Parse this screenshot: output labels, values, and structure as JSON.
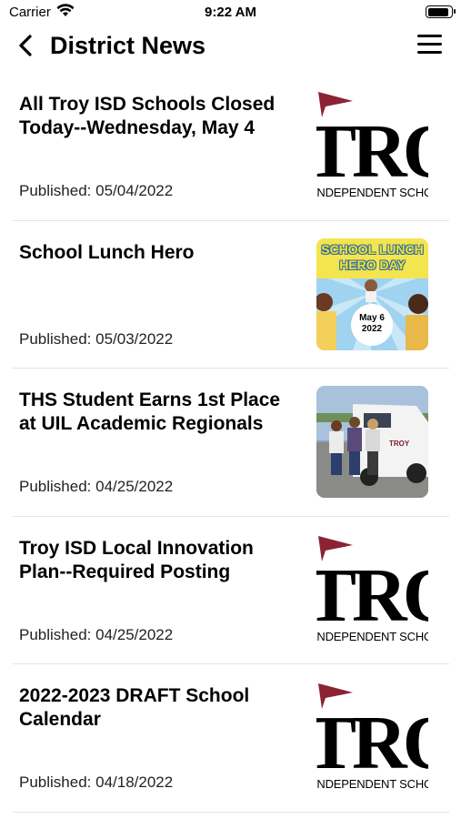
{
  "status_bar": {
    "carrier": "Carrier",
    "time": "9:22 AM"
  },
  "nav": {
    "title": "District News",
    "back_icon": "chevron-left-icon",
    "menu_icon": "hamburger-menu-icon"
  },
  "logo": {
    "letters": "TRO",
    "subtitle": "INDEPENDENT SCHOOL",
    "flag_color": "#8b2335"
  },
  "lunch_thumb": {
    "heading": "SCHOOL LUNCH HERO DAY",
    "date_line1": "May 6",
    "date_line2": "2022"
  },
  "photo_thumb": {
    "truck_text": "TROY"
  },
  "news": [
    {
      "title": "All Troy ISD Schools Closed Today--Wednesday, May 4",
      "date": "Published: 05/04/2022",
      "thumbnail": "logo"
    },
    {
      "title": "School Lunch Hero",
      "date": "Published: 05/03/2022",
      "thumbnail": "lunch-hero"
    },
    {
      "title": "THS Student Earns 1st Place at UIL Academic Regionals",
      "date": "Published: 04/25/2022",
      "thumbnail": "photo"
    },
    {
      "title": "Troy ISD Local Innovation Plan--Required Posting",
      "date": "Published: 04/25/2022",
      "thumbnail": "logo"
    },
    {
      "title": "2022-2023 DRAFT School Calendar",
      "date": "Published: 04/18/2022",
      "thumbnail": "logo"
    }
  ]
}
